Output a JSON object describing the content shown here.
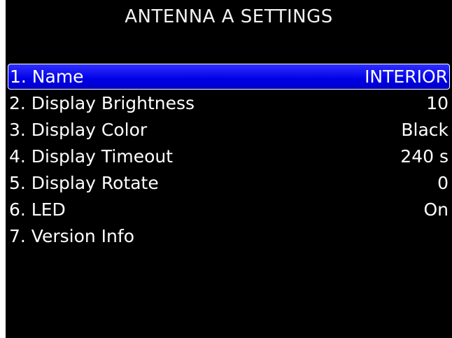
{
  "header": {
    "title": "ANTENNA A SETTINGS"
  },
  "menu": {
    "items": [
      {
        "label": "1. Name",
        "value": "INTERIOR",
        "selected": true
      },
      {
        "label": "2. Display Brightness",
        "value": "10",
        "selected": false
      },
      {
        "label": "3. Display Color",
        "value": "Black",
        "selected": false
      },
      {
        "label": "4. Display Timeout",
        "value": "240 s",
        "selected": false
      },
      {
        "label": "5. Display Rotate",
        "value": "0",
        "selected": false
      },
      {
        "label": "6. LED",
        "value": "On",
        "selected": false
      },
      {
        "label": "7. Version Info",
        "value": "",
        "selected": false
      }
    ]
  },
  "colors": {
    "background": "#000000",
    "text": "#ffffff",
    "highlight": "#0000e6"
  }
}
